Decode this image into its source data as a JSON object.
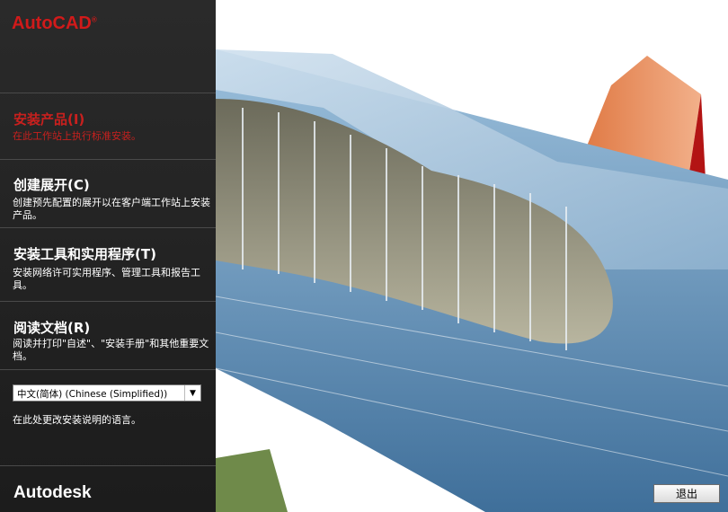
{
  "app": {
    "logo": "AutoCAD",
    "logo_mark": "®"
  },
  "menu": [
    {
      "title": "安装产品(I)",
      "desc": "在此工作站上执行标准安装。",
      "active": true
    },
    {
      "title": "创建展开(C)",
      "desc": "创建预先配置的展开以在客户端工作站上安装产品。",
      "active": false
    },
    {
      "title": "安装工具和实用程序(T)",
      "desc": "安装网络许可实用程序、管理工具和报告工具。",
      "active": false
    },
    {
      "title": "阅读文档(R)",
      "desc": "阅读并打印\"自述\"、\"安装手册\"和其他重要文档。",
      "active": false
    }
  ],
  "language": {
    "selected": "中文(简体) (Chinese (Simplified))",
    "note": "在此处更改安装说明的语言。"
  },
  "footer": {
    "brand": "Autodesk"
  },
  "buttons": {
    "exit": "退出"
  },
  "colors": {
    "accent": "#c8201e",
    "panel_bg": "#222222"
  },
  "icons": {
    "dropdown": "chevron-down-icon"
  }
}
